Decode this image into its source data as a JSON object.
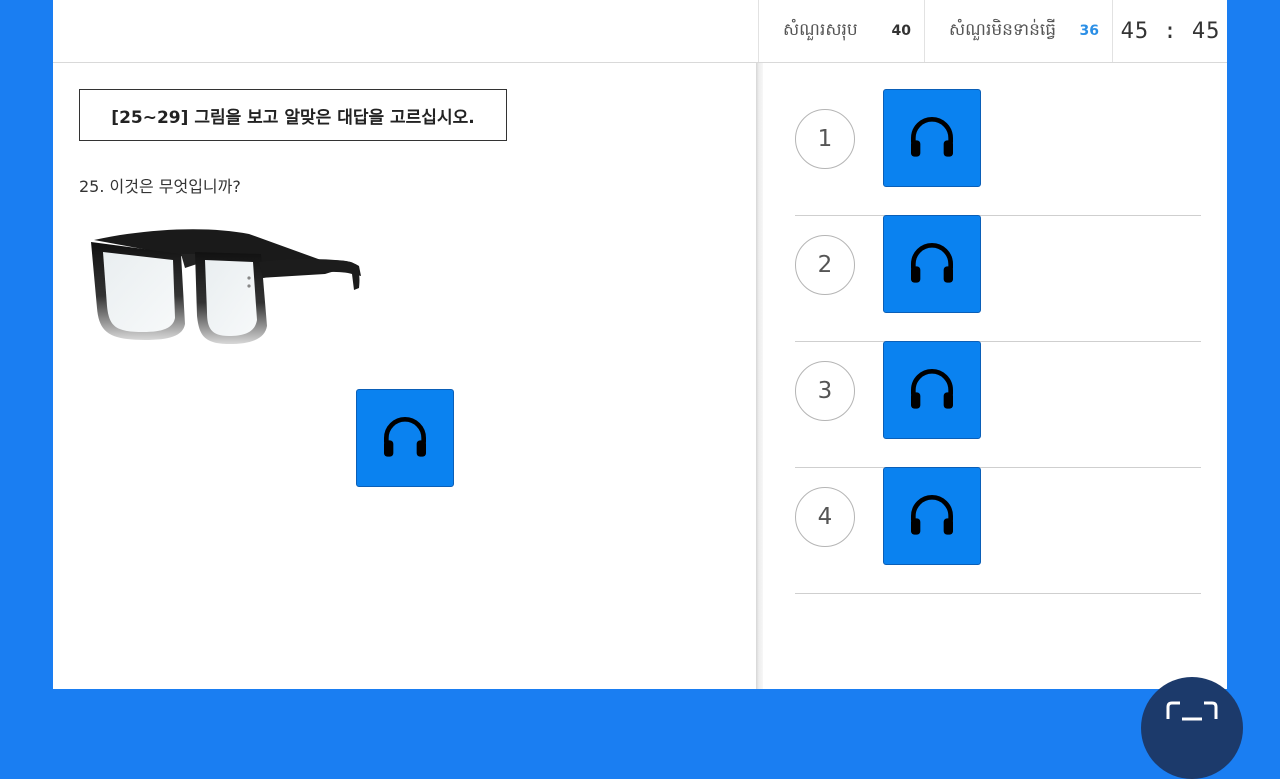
{
  "header": {
    "total_label": "សំណួរសរុប",
    "total_value": "40",
    "unanswered_label": "សំណួរមិនទាន់ធ្វើ",
    "unanswered_value": "36",
    "timer": "45 : 45"
  },
  "question": {
    "instruction": "[25~29] 그림을 보고 알맞은 대답을 고르십시오.",
    "text": "25.  이것은 무엇입니까?",
    "image_icon": "eyeglasses",
    "audio_icon": "headphones-icon"
  },
  "options": [
    {
      "number": "1",
      "audio_icon": "headphones-icon"
    },
    {
      "number": "2",
      "audio_icon": "headphones-icon"
    },
    {
      "number": "3",
      "audio_icon": "headphones-icon"
    },
    {
      "number": "4",
      "audio_icon": "headphones-icon"
    }
  ],
  "colors": {
    "page_background": "#1a7ef2",
    "audio_button": "#0a82f0",
    "unanswered_count": "#2b8fe6",
    "floating_button": "#1c3a6b"
  },
  "floating_button_icon": "scan-icon"
}
